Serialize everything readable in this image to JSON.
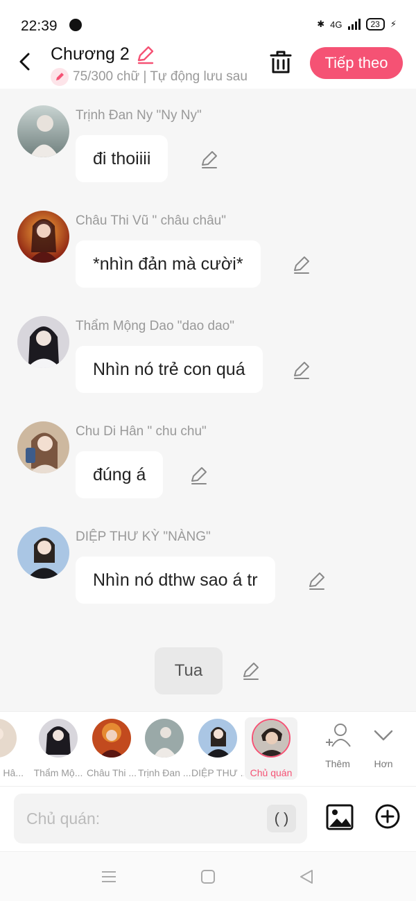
{
  "status_bar": {
    "time": "22:39",
    "network": "4G",
    "battery": "23"
  },
  "header": {
    "title": "Chương 2",
    "subtitle": "75/300 chữ | Tự động lưu sau",
    "next_label": "Tiếp theo"
  },
  "messages": [
    {
      "sender": "Trịnh Đan Ny \"Ny Ny\"",
      "text": "đi thoiiii",
      "avatar_color": "#9aa9a8"
    },
    {
      "sender": "Châu Thi Vũ \" châu châu\"",
      "text": "*nhìn đản mà cười*",
      "avatar_color": "#b0401e"
    },
    {
      "sender": "Thẩm Mộng Dao \"dao dao\"",
      "text": "Nhìn nó trẻ con quá",
      "avatar_color": "#4a4650"
    },
    {
      "sender": "Chu Di Hân \" chu chu\"",
      "text": "đúng á",
      "avatar_color": "#a8866a"
    },
    {
      "sender": "DIỆP THƯ KỲ \"NÀNG\"",
      "text": "Nhìn nó dthw sao á tr",
      "avatar_color": "#5c7ea6"
    }
  ],
  "narration": {
    "text": "Tua"
  },
  "characters": [
    {
      "name": "Hâ...",
      "color": "#d9c7b8"
    },
    {
      "name": "Thẩm Mộ...",
      "color": "#4a4650"
    },
    {
      "name": "Châu Thi ...",
      "color": "#b0401e"
    },
    {
      "name": "Trịnh Đan ...",
      "color": "#9aa9a8"
    },
    {
      "name": "DIỆP THƯ ...",
      "color": "#5c7ea6"
    },
    {
      "name": "Chủ quán",
      "color": "#3a2f2b"
    }
  ],
  "strip_actions": {
    "add_label": "Thêm",
    "more_label": "Hơn"
  },
  "input": {
    "placeholder": "Chủ quán:",
    "paren_label": "( )"
  },
  "colors": {
    "accent": "#f55274",
    "background": "#f6f6f6"
  }
}
